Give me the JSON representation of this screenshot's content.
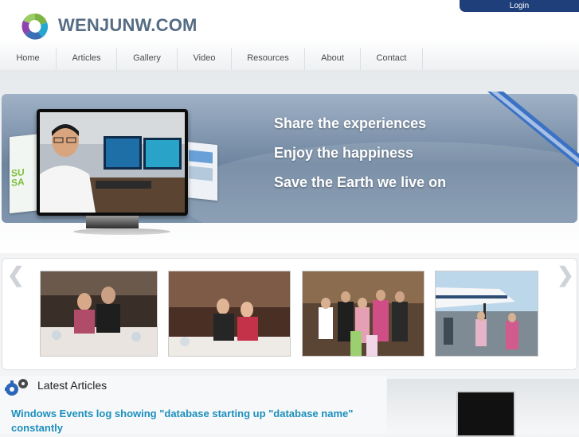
{
  "header": {
    "login_label": "Login",
    "site_title": "WENJUNW.COM",
    "nav": [
      "Home",
      "Articles",
      "Gallery",
      "Video",
      "Resources",
      "About",
      "Contact"
    ]
  },
  "banner": {
    "taglines": [
      "Share the experiences",
      "Enjoy the happiness",
      "Save the Earth we live on"
    ],
    "brochure_text": "SU SA"
  },
  "gallery": {
    "prev_icon": "chevron-left-icon",
    "next_icon": "chevron-right-icon"
  },
  "articles": {
    "section_title": "Latest Articles",
    "latest_link": "Windows Events log showing \"database starting up \"database name\" constantly"
  },
  "colors": {
    "accent": "#1f3f7a",
    "link": "#1b8fbe",
    "banner": "#7f95ad",
    "title": "#566c84"
  }
}
